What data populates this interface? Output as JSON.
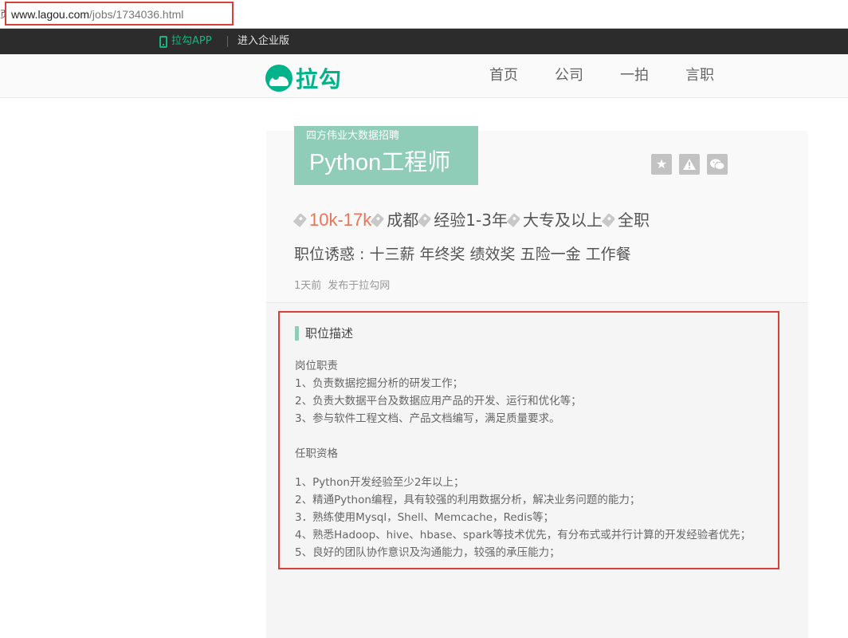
{
  "browser": {
    "favicon": "页",
    "url_host": "www.lagou.com",
    "url_path": "/jobs/1734036.html"
  },
  "topbar": {
    "app_link": "拉勾APP",
    "enterprise_link": "进入企业版"
  },
  "header": {
    "logo_text": "拉勾",
    "nav": [
      "首页",
      "公司",
      "一拍",
      "言职"
    ]
  },
  "job": {
    "company": "四方伟业大数据招聘",
    "title": "Python工程师",
    "salary": "10k-17k",
    "city": "成都",
    "experience": "经验1-3年",
    "education": "大专及以上",
    "job_type": "全职",
    "perks": "职位诱惑 : 十三薪 年终奖 绩效奖 五险一金 工作餐",
    "posted_time": "1天前",
    "posted_source": "发布于拉勾网"
  },
  "icons": {
    "favorite": "star-icon",
    "report": "warning-icon",
    "share": "wechat-icon"
  },
  "description": {
    "title": "职位描述",
    "duties_heading": "岗位职责",
    "duties": [
      "1、负责数据挖掘分析的研发工作；",
      "2、负责大数据平台及数据应用产品的开发、运行和优化等；",
      "3、参与软件工程文档、产品文档编写，满足质量要求。"
    ],
    "requirements_heading": "任职资格",
    "requirements": [
      "1、Python开发经验至少2年以上；",
      "2、精通Python编程，具有较强的利用数据分析，解决业务问题的能力；",
      "3．熟练使用Mysql，Shell、Memcache，Redis等；",
      "4、熟悉Hadoop、hive、hbase、spark等技术优先，有分布式或并行计算的开发经验者优先；",
      "5、良好的团队协作意识及沟通能力，较强的承压能力；"
    ]
  },
  "colors": {
    "brand": "#00b38a",
    "title_box": "#8fcdb8",
    "salary": "#e97558",
    "highlight": "#d9403a"
  }
}
